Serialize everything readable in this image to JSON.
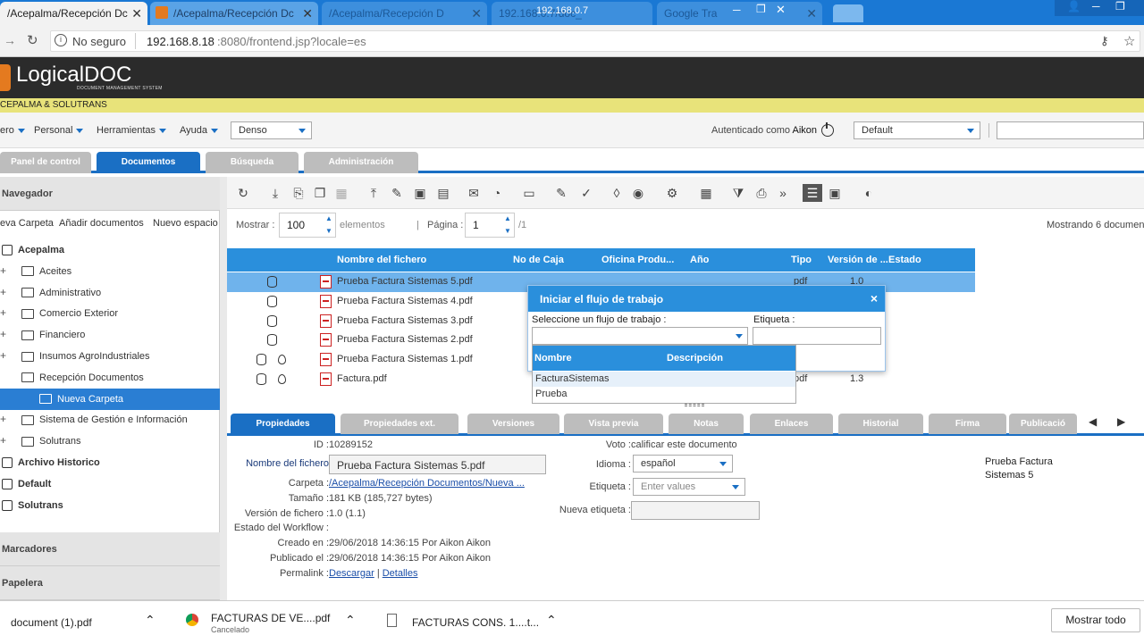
{
  "browser": {
    "tabs": [
      {
        "title": "/Acepalma/Recepción Dc",
        "active": true
      },
      {
        "title": "/Acepalma/Recepción Dc",
        "active": false
      },
      {
        "title": "/Acepalma/Recepción D",
        "active": false
      },
      {
        "title": "192.168.0.7/doc_",
        "active": false
      },
      {
        "title": "Google Tra",
        "active": false
      }
    ],
    "window_title": "192.168.0.7",
    "security": "No seguro",
    "url_host": "192.168.8.18",
    "url_rest": ":8080/frontend.jsp?locale=es"
  },
  "app": {
    "logo_text": "LogicalDOC",
    "logo_sub": "DOCUMENT MANAGEMENT SYSTEM",
    "company": "CEPALMA & SOLUTRANS",
    "menu": [
      "ero",
      "Personal",
      "Herramientas",
      "Ayuda"
    ],
    "density": "Denso",
    "auth_text": "Autenticado como",
    "user": "Aikon",
    "workspace": "Default",
    "main_tabs": [
      "Panel de control",
      "Documentos",
      "Búsqueda",
      "Administración"
    ]
  },
  "navigator": {
    "title": "Navegador",
    "actions": [
      "eva Carpeta",
      "Añadir documentos",
      "Nuevo espacio c"
    ],
    "tree": [
      {
        "label": "Acepalma",
        "type": "root",
        "level": 0
      },
      {
        "label": "Aceites",
        "type": "folder",
        "level": 1
      },
      {
        "label": "Administrativo",
        "type": "folder",
        "level": 1
      },
      {
        "label": "Comercio Exterior",
        "type": "folder",
        "level": 1
      },
      {
        "label": "Financiero",
        "type": "folder",
        "level": 1
      },
      {
        "label": "Insumos AgroIndustriales",
        "type": "folder",
        "level": 1
      },
      {
        "label": "Recepción Documentos",
        "type": "folder-open",
        "level": 1
      },
      {
        "label": "Nueva Carpeta",
        "type": "folder-open",
        "level": 2,
        "selected": true
      },
      {
        "label": "Sistema de Gestión e Información",
        "type": "folder",
        "level": 1
      },
      {
        "label": "Solutrans",
        "type": "folder",
        "level": 1
      },
      {
        "label": "Archivo Historico",
        "type": "root",
        "level": 0
      },
      {
        "label": "Default",
        "type": "root",
        "level": 0
      },
      {
        "label": "Solutrans",
        "type": "root",
        "level": 0
      }
    ],
    "bookmarks": "Marcadores",
    "trash": "Papelera"
  },
  "pager": {
    "show_label": "Mostrar :",
    "show_value": "100",
    "elements_label": "elementos",
    "page_label": "Página :",
    "page_value": "1",
    "page_total": "/1",
    "showing": "Mostrando 6 documen"
  },
  "grid": {
    "columns": [
      "Nombre del fichero",
      "No de Caja",
      "Oficina Produ...",
      "Año",
      "Tipo",
      "Versión de ...",
      "Estado"
    ],
    "rows": [
      {
        "name": "Prueba Factura Sistemas 5.pdf",
        "type": "pdf",
        "version": "1.0",
        "selected": true,
        "drop": false
      },
      {
        "name": "Prueba Factura Sistemas 4.pdf",
        "type": "",
        "version": "",
        "selected": false,
        "drop": false
      },
      {
        "name": "Prueba Factura Sistemas 3.pdf",
        "type": "",
        "version": "",
        "selected": false,
        "drop": false
      },
      {
        "name": "Prueba Factura Sistemas 2.pdf",
        "type": "",
        "version": "",
        "selected": false,
        "drop": false
      },
      {
        "name": "Prueba Factura Sistemas 1.pdf",
        "type": "",
        "version": "",
        "selected": false,
        "drop": true
      },
      {
        "name": "Factura.pdf",
        "type": "pdf",
        "version": "1.3",
        "selected": false,
        "drop": true
      }
    ]
  },
  "detail_tabs": [
    "Propiedades",
    "Propiedades ext.",
    "Versiones",
    "Vista previa",
    "Notas",
    "Enlaces",
    "Historial",
    "Firma",
    "Publicació"
  ],
  "properties": {
    "id_label": "ID :",
    "id": "10289152",
    "filename_label": "Nombre del fichero",
    "filename": "Prueba Factura Sistemas 5.pdf",
    "folder_label": "Carpeta :",
    "folder": "/Acepalma/Recepción Documentos/Nueva ...",
    "size_label": "Tamaño :",
    "size": "181 KB (185,727 bytes)",
    "version_label": "Versión de fichero :",
    "version": "1.0 (1.1)",
    "workflow_label": "Estado del Workflow :",
    "created_label": "Creado en :",
    "created": "29/06/2018 14:36:15 Por Aikon Aikon",
    "published_label": "Publicado el :",
    "published": "29/06/2018 14:36:15 Por Aikon Aikon",
    "permalink_label": "Permalink :",
    "download": "Descargar",
    "sep": "|",
    "details": "Detalles",
    "vote_label": "Voto :",
    "vote": "calificar este documento",
    "language_label": "Idioma :",
    "language": "español",
    "tags_label": "Etiqueta :",
    "tags_placeholder": "Enter values",
    "new_tag_label": "Nueva etiqueta :",
    "preview_title": "Prueba Factura Sistemas 5"
  },
  "dialog": {
    "title": "Iniciar el flujo de trabajo",
    "close": "×",
    "workflow_label": "Seleccione un flujo de trabajo :",
    "tag_label": "Etiqueta :",
    "list_cols": [
      "Nombre",
      "Descripción"
    ],
    "options": [
      "FacturaSistemas",
      "Prueba"
    ]
  },
  "downloads": {
    "items": [
      {
        "name": "document (1).pdf",
        "status": ""
      },
      {
        "name": "FACTURAS DE VE....pdf",
        "status": "Cancelado"
      },
      {
        "name": "FACTURAS CONS. 1....t...",
        "status": ""
      }
    ],
    "show_all": "Mostrar todo"
  }
}
